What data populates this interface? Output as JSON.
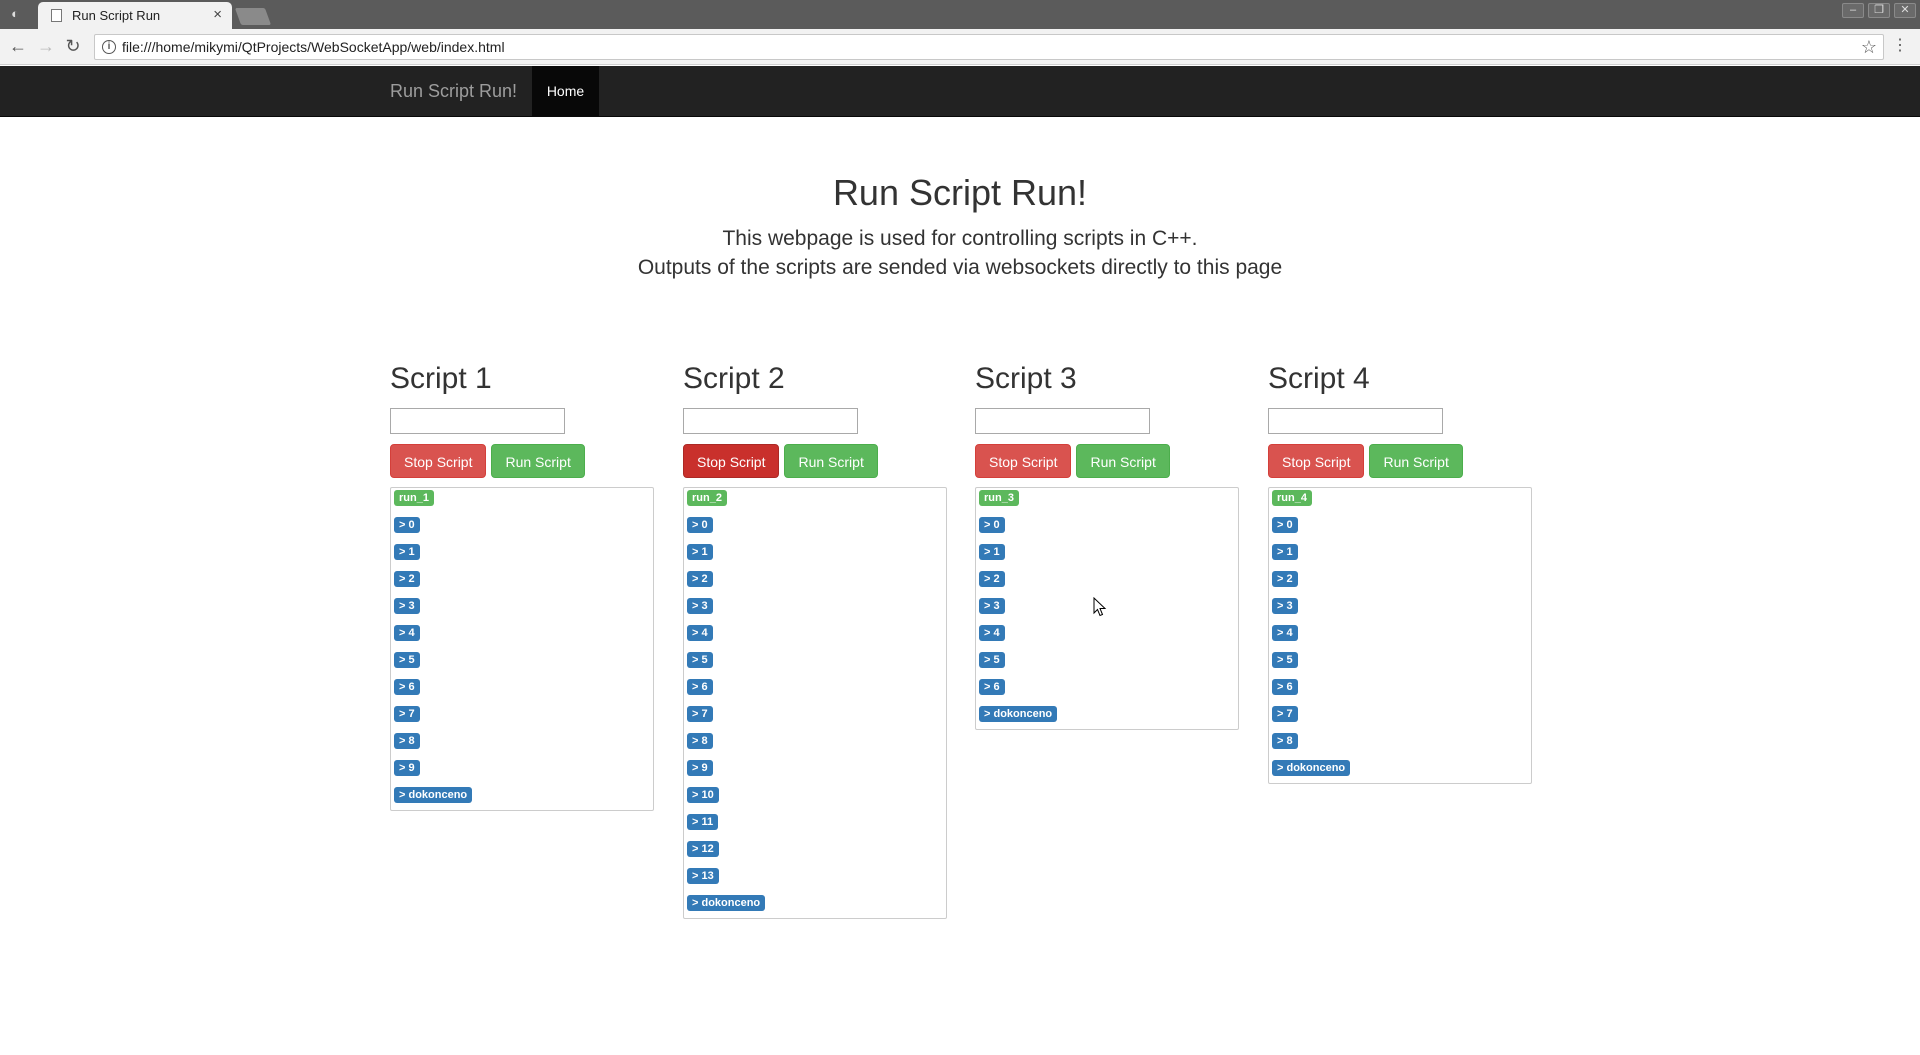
{
  "browser": {
    "tab_title": "Run Script Run",
    "tab_close": "×",
    "url": "file:///home/mikymi/QtProjects/WebSocketApp/web/index.html",
    "window_buttons": [
      "–",
      "❐",
      "✕"
    ]
  },
  "navbar": {
    "brand": "Run Script Run!",
    "home": "Home"
  },
  "hero": {
    "title": "Run Script Run!",
    "line1": "This webpage is used for controlling scripts in C++.",
    "line2": "Outputs of the scripts are sended via websockets directly to this page"
  },
  "scripts": [
    {
      "title": "Script 1",
      "input_value": "",
      "stop_label": "Stop Script",
      "run_label": "Run Script",
      "outputs": [
        "run_1",
        "> 0",
        "> 1",
        "> 2",
        "> 3",
        "> 4",
        "> 5",
        "> 6",
        "> 7",
        "> 8",
        "> 9",
        "> dokonceno"
      ]
    },
    {
      "title": "Script 2",
      "input_value": "",
      "stop_label": "Stop Script",
      "run_label": "Run Script",
      "outputs": [
        "run_2",
        "> 0",
        "> 1",
        "> 2",
        "> 3",
        "> 4",
        "> 5",
        "> 6",
        "> 7",
        "> 8",
        "> 9",
        "> 10",
        "> 11",
        "> 12",
        "> 13",
        "> dokonceno"
      ]
    },
    {
      "title": "Script 3",
      "input_value": "",
      "stop_label": "Stop Script",
      "run_label": "Run Script",
      "outputs": [
        "run_3",
        "> 0",
        "> 1",
        "> 2",
        "> 3",
        "> 4",
        "> 5",
        "> 6",
        "> dokonceno"
      ]
    },
    {
      "title": "Script 4",
      "input_value": "",
      "stop_label": "Stop Script",
      "run_label": "Run Script",
      "outputs": [
        "run_4",
        "> 0",
        "> 1",
        "> 2",
        "> 3",
        "> 4",
        "> 5",
        "> 6",
        "> 7",
        "> 8",
        "> dokonceno"
      ]
    }
  ],
  "colors": {
    "danger": "#d9534f",
    "success": "#5cb85c",
    "primary": "#337ab7",
    "navbar": "#222222"
  }
}
